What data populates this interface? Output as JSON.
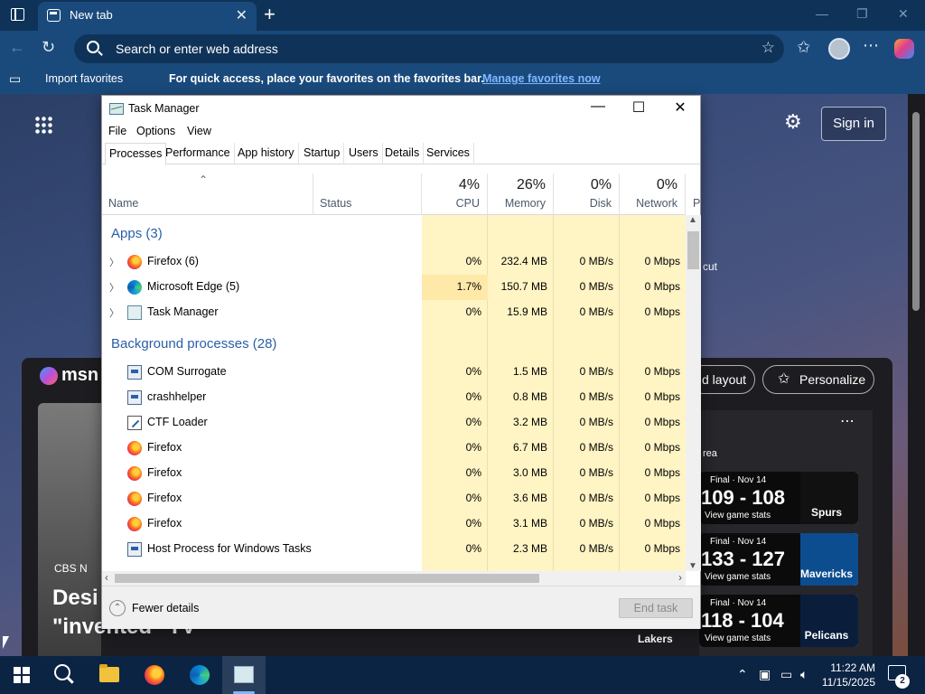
{
  "browser": {
    "tab_title": "New tab",
    "address_placeholder": "Search or enter web address",
    "import_favorites": "Import favorites",
    "favbar_message": "For quick access, place your favorites on the favorites bar.",
    "manage_favorites": "Manage favorites now"
  },
  "ntp": {
    "signin": "Sign in",
    "shortcut_fragment": "cut",
    "msn": "msn",
    "layout_btn": "d layout",
    "personalize_btn": "Personalize",
    "news_source": "CBS N",
    "news_headline_1": "Desi",
    "news_headline_2": "\"invented\" TV",
    "sports_area": "rea",
    "lakers": "Lakers",
    "scores": [
      {
        "status": "Final · Nov 14",
        "score": "109 - 108",
        "stats": "View game stats",
        "team": "Spurs",
        "color": "#111111"
      },
      {
        "status": "Final · Nov 14",
        "score": "133 - 127",
        "stats": "View game stats",
        "team": "Mavericks",
        "color": "#0b4d8f"
      },
      {
        "status": "Final · Nov 14",
        "score": "118 - 104",
        "stats": "View game stats",
        "team": "Pelicans",
        "color": "#0a1e3c"
      }
    ]
  },
  "taskmgr": {
    "title": "Task Manager",
    "menu": [
      "File",
      "Options",
      "View"
    ],
    "tabs": [
      "Processes",
      "Performance",
      "App history",
      "Startup",
      "Users",
      "Details",
      "Services"
    ],
    "columns": {
      "name": "Name",
      "status": "Status",
      "cpu_pct": "4%",
      "cpu": "CPU",
      "mem_pct": "26%",
      "mem": "Memory",
      "disk_pct": "0%",
      "disk": "Disk",
      "net_pct": "0%",
      "net": "Network",
      "power_fragment": "P"
    },
    "groups": {
      "apps": "Apps (3)",
      "background": "Background processes (28)"
    },
    "apps": [
      {
        "name": "Firefox (6)",
        "cpu": "0%",
        "mem": "232.4 MB",
        "disk": "0 MB/s",
        "net": "0 Mbps",
        "icon": "firefox-icon"
      },
      {
        "name": "Microsoft Edge (5)",
        "cpu": "1.7%",
        "mem": "150.7 MB",
        "disk": "0 MB/s",
        "net": "0 Mbps",
        "icon": "edge-icon"
      },
      {
        "name": "Task Manager",
        "cpu": "0%",
        "mem": "15.9 MB",
        "disk": "0 MB/s",
        "net": "0 Mbps",
        "icon": "task-manager-icon"
      }
    ],
    "background": [
      {
        "name": "COM Surrogate",
        "cpu": "0%",
        "mem": "1.5 MB",
        "disk": "0 MB/s",
        "net": "0 Mbps",
        "icon": "service-icon"
      },
      {
        "name": "crashhelper",
        "cpu": "0%",
        "mem": "0.8 MB",
        "disk": "0 MB/s",
        "net": "0 Mbps",
        "icon": "service-icon"
      },
      {
        "name": "CTF Loader",
        "cpu": "0%",
        "mem": "3.2 MB",
        "disk": "0 MB/s",
        "net": "0 Mbps",
        "icon": "ctf-loader-icon"
      },
      {
        "name": "Firefox",
        "cpu": "0%",
        "mem": "6.7 MB",
        "disk": "0 MB/s",
        "net": "0 Mbps",
        "icon": "firefox-icon"
      },
      {
        "name": "Firefox",
        "cpu": "0%",
        "mem": "3.0 MB",
        "disk": "0 MB/s",
        "net": "0 Mbps",
        "icon": "firefox-icon"
      },
      {
        "name": "Firefox",
        "cpu": "0%",
        "mem": "3.6 MB",
        "disk": "0 MB/s",
        "net": "0 Mbps",
        "icon": "firefox-icon"
      },
      {
        "name": "Firefox",
        "cpu": "0%",
        "mem": "3.1 MB",
        "disk": "0 MB/s",
        "net": "0 Mbps",
        "icon": "firefox-icon"
      },
      {
        "name": "Host Process for Windows Tasks",
        "cpu": "0%",
        "mem": "2.3 MB",
        "disk": "0 MB/s",
        "net": "0 Mbps",
        "icon": "service-icon"
      }
    ],
    "fewer_details": "Fewer details",
    "end_task": "End task"
  },
  "taskbar": {
    "time": "11:22 AM",
    "date": "11/15/2025",
    "notifications": "2"
  }
}
